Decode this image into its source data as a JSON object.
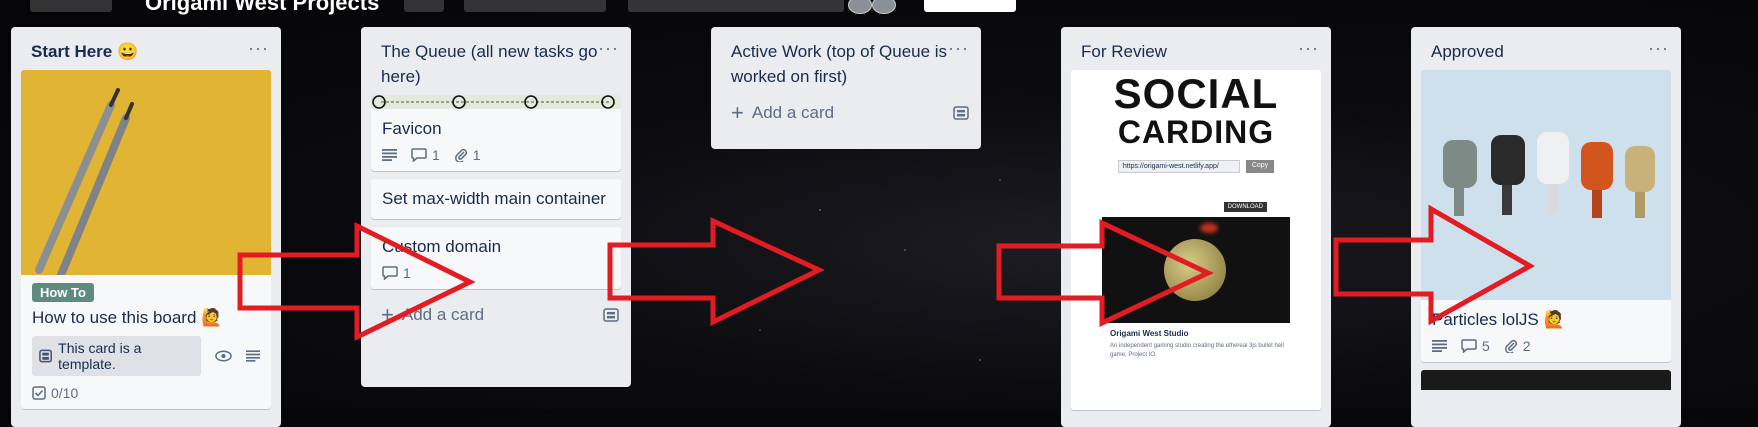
{
  "board": {
    "title": "Origami West Projects"
  },
  "lists": [
    {
      "title": "Start Here",
      "title_emoji": "😀",
      "card": {
        "label": "How To",
        "title": "How to use this board",
        "title_emoji": "🙋",
        "template_text": "This card is a template.",
        "checklist": "0/10"
      }
    },
    {
      "title": "The Queue (all new tasks go here)",
      "cards": [
        {
          "title": "Favicon",
          "comments": "1",
          "attachments": "1"
        },
        {
          "title": "Set max-width main container"
        },
        {
          "title": "Custom domain",
          "comments": "1"
        }
      ],
      "add_card": "Add a card"
    },
    {
      "title": "Active Work (top of Queue is worked on first)",
      "add_card": "Add a card"
    },
    {
      "title": "For Review",
      "preview": {
        "heading_line1": "SOCIAL",
        "heading_line2": "CARDING",
        "url": "https://origami-west.netlify.app/",
        "copy_button": "Copy",
        "download_button": "DOWNLOAD",
        "site_name": "Origami West Studio",
        "site_desc": "An independent gaming studio creating the ethereal 3js bullet hell game, Project IO."
      }
    },
    {
      "title": "Approved",
      "card": {
        "title": "Particles lolJS",
        "title_emoji": "🙋",
        "comments": "5",
        "attachments": "2"
      }
    }
  ],
  "colors": {
    "arrow": "#e31b23",
    "list_bg": "#ebecf0",
    "label_green": "#5e8b7e"
  }
}
